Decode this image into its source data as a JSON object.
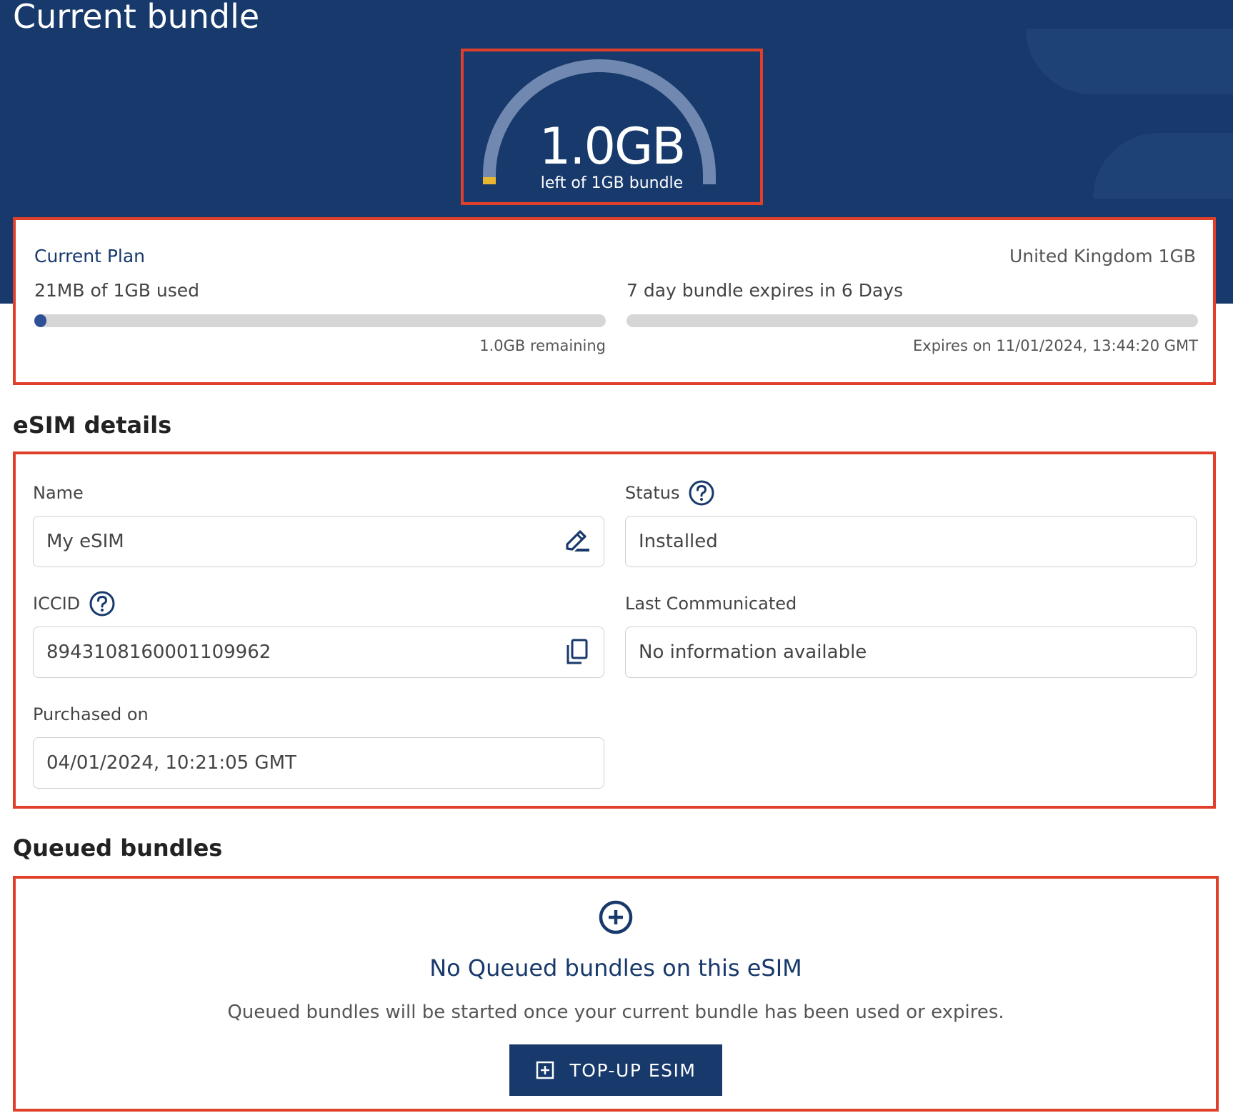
{
  "header": {
    "title": "Current bundle"
  },
  "gauge": {
    "value": "1.0GB",
    "subtitle": "left of 1GB bundle",
    "remaining_fraction": 0.98
  },
  "plan": {
    "title": "Current Plan",
    "name": "United Kingdom 1GB",
    "usage_label": "21MB of 1GB used",
    "usage_fraction": 0.021,
    "remaining_label": "1.0GB remaining",
    "expiry_label": "7 day bundle expires in 6 Days",
    "expiry_fraction": 0.0,
    "expires_on": "Expires on 11/01/2024, 13:44:20 GMT"
  },
  "esim": {
    "section_title": "eSIM details",
    "name_label": "Name",
    "name_value": "My eSIM",
    "status_label": "Status",
    "status_value": "Installed",
    "iccid_label": "ICCID",
    "iccid_value": "8943108160001109962",
    "last_comm_label": "Last Communicated",
    "last_comm_value": "No information available",
    "purchased_label": "Purchased on",
    "purchased_value": "04/01/2024, 10:21:05 GMT"
  },
  "queued": {
    "section_title": "Queued bundles",
    "empty_title": "No Queued bundles on this eSIM",
    "empty_desc": "Queued bundles will be started once your current bundle has been used or expires.",
    "button_label": "TOP-UP ESIM"
  },
  "colors": {
    "brand": "#17396b",
    "gauge_track": "#7189b0",
    "gauge_used": "#e8b631",
    "highlight": "#e0402b"
  },
  "icons": {
    "edit": "edit-pencil-icon",
    "copy": "copy-icon",
    "help": "help-circle-icon",
    "add": "add-circle-icon",
    "add_square": "add-square-icon"
  }
}
